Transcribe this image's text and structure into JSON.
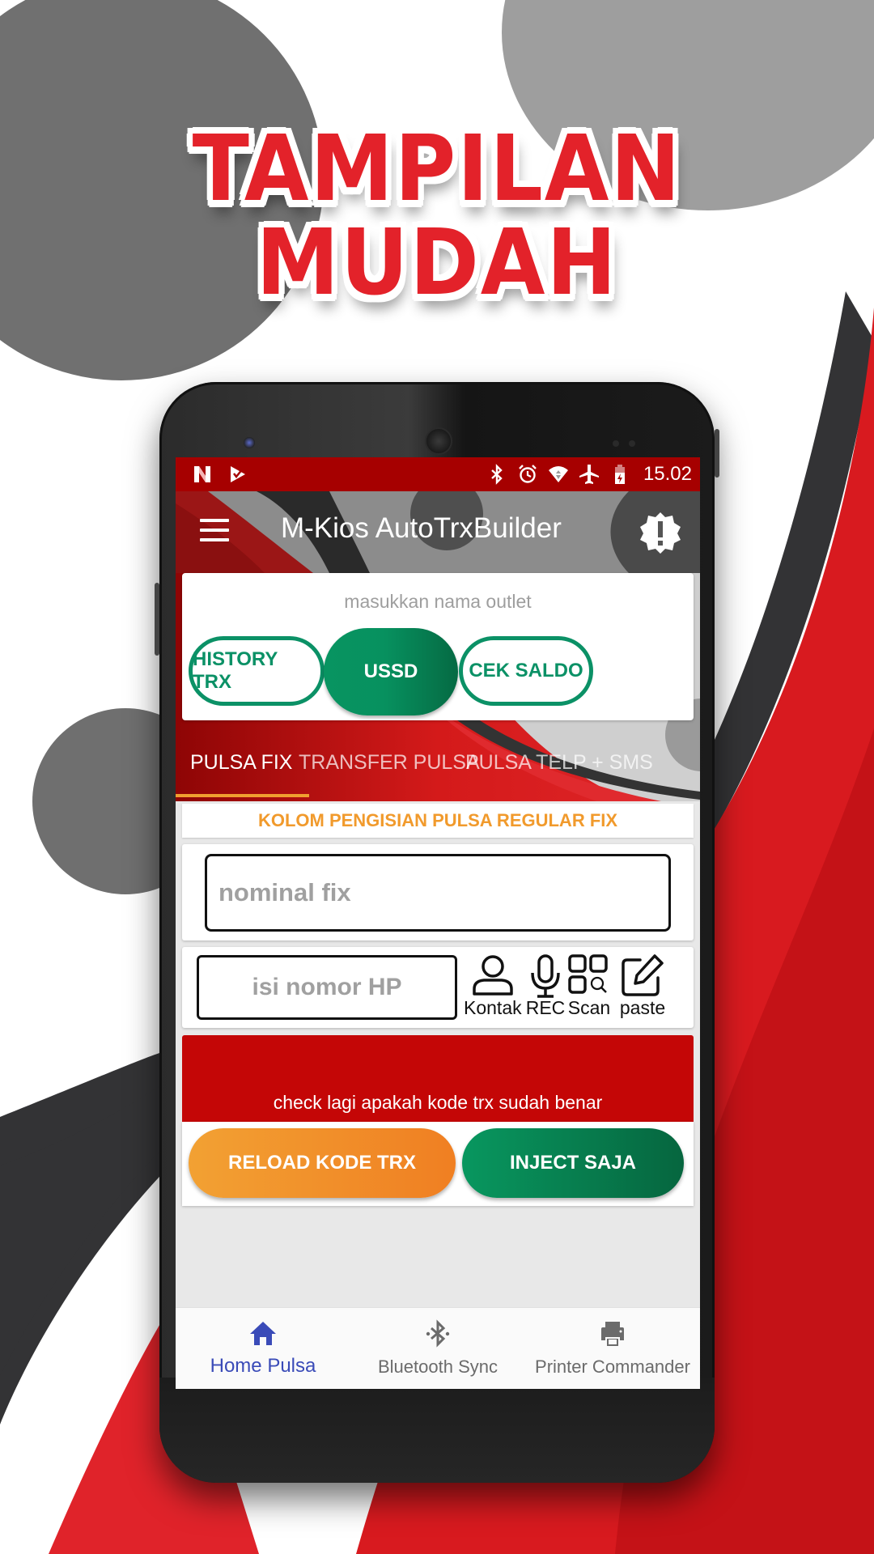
{
  "headline": {
    "line1": "TAMPILAN",
    "line2": "MUDAH"
  },
  "status_bar": {
    "left_icons": [
      "n-notification-icon",
      "play-store-check-icon"
    ],
    "right_icons": [
      "bluetooth-icon",
      "alarm-icon",
      "wifi-icon",
      "airplane-mode-icon",
      "battery-charging-icon"
    ],
    "time": "15.02"
  },
  "app_bar": {
    "title": "M-Kios AutoTrxBuilder",
    "menu_icon": "hamburger-menu-icon",
    "action_icon": "alert-badge-icon"
  },
  "outlet": {
    "placeholder": "masukkan nama outlet",
    "value": "",
    "buttons": {
      "history": "HISTORY TRX",
      "ussd": "USSD",
      "cek_saldo": "CEK SALDO"
    }
  },
  "tabs": [
    {
      "label": "PULSA FIX",
      "active": true
    },
    {
      "label": "TRANSFER PULSA",
      "active": false
    },
    {
      "label": "PULSA TELP + SMS",
      "active": false
    }
  ],
  "form": {
    "section_label": "KOLOM PENGISIAN PULSA REGULAR FIX",
    "nominal_placeholder": "nominal fix",
    "nominal_value": "",
    "phone_placeholder": "isi nomor HP",
    "phone_value": "",
    "tools": [
      {
        "label": "Kontak",
        "icon": "contact-person-icon"
      },
      {
        "label": "REC",
        "icon": "microphone-icon"
      },
      {
        "label": "Scan",
        "icon": "qr-scan-icon"
      },
      {
        "label": "paste",
        "icon": "edit-paste-icon"
      }
    ],
    "notice": "check lagi apakah kode trx sudah benar",
    "reload_button": "RELOAD KODE TRX",
    "inject_button": "INJECT SAJA"
  },
  "bottom_nav": [
    {
      "label": "Home Pulsa",
      "icon": "home-icon",
      "active": true
    },
    {
      "label": "Bluetooth Sync",
      "icon": "bluetooth-icon",
      "active": false
    },
    {
      "label": "Printer Commander",
      "icon": "printer-icon",
      "active": false
    }
  ],
  "colors": {
    "brand_red": "#c40606",
    "status_bar_red": "#a60000",
    "green": "#0b9166",
    "orange": "#f19a2c",
    "nav_active": "#3a4bb8",
    "nav_inactive": "#6b6b6b"
  }
}
